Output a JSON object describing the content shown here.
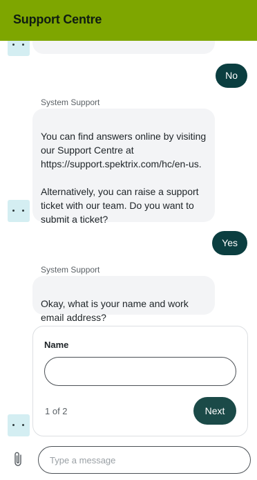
{
  "header": {
    "title": "Support Centre"
  },
  "messages": {
    "bot_partial": {
      "text": ""
    },
    "user_no": {
      "text": "No"
    },
    "bot_answer": {
      "sender": "System Support",
      "text": "You can find answers online by visiting our Support Centre at https://support.spektrix.com/hc/en-us.\n\nAlternatively, you can raise a support ticket with our team. Do you want to submit a ticket?"
    },
    "user_yes": {
      "text": "Yes"
    },
    "bot_question": {
      "sender": "System Support",
      "text": "Okay, what is your name and work email address?"
    }
  },
  "form": {
    "label": "Name",
    "value": "",
    "step": "1 of 2",
    "next_label": "Next"
  },
  "composer": {
    "placeholder": "Type a message",
    "attach_icon": "paperclip-icon"
  },
  "colors": {
    "header_bg": "#7ea600",
    "user_bubble": "#0b3e40",
    "next_button": "#1b4a48",
    "bot_bubble": "#f3f4f6",
    "avatar_bg": "#d4eef2"
  }
}
